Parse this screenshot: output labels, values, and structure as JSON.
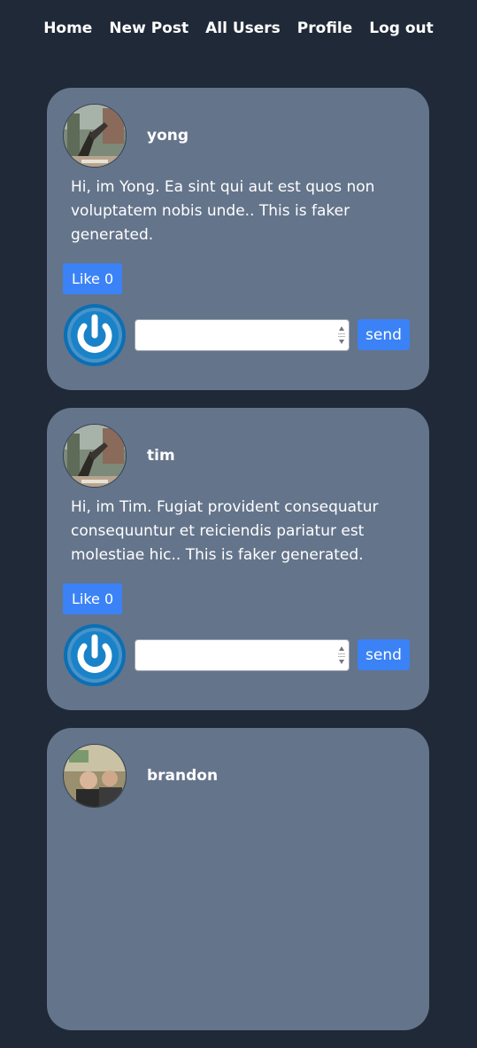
{
  "nav": {
    "items": [
      {
        "label": "Home",
        "icon": null
      },
      {
        "label": "New Post",
        "icon": null
      },
      {
        "label": "All Users",
        "icon": null
      },
      {
        "label": "Profile",
        "icon": null
      },
      {
        "label": "Log out",
        "icon": null
      }
    ]
  },
  "colors": {
    "page_bg": "#1f2937",
    "card_bg": "#64748b",
    "accent": "#3b82f6",
    "power_icon": "#0b6fb4"
  },
  "posts": [
    {
      "username": "yong",
      "avatar_icon": "user-photo-icon",
      "text": "Hi, im Yong. Ea sint qui aut est quos non voluptatem nobis unde.. This is faker generated.",
      "like_label": "Like 0",
      "comment": {
        "value": "",
        "placeholder": ""
      },
      "send_label": "send"
    },
    {
      "username": "tim",
      "avatar_icon": "user-photo-icon",
      "text": "Hi, im Tim. Fugiat provident consequatur consequuntur et reiciendis pariatur est molestiae hic.. This is faker generated.",
      "like_label": "Like 0",
      "comment": {
        "value": "",
        "placeholder": ""
      },
      "send_label": "send"
    },
    {
      "username": "brandon",
      "avatar_icon": "user-photo-icon",
      "text": "",
      "like_label": "",
      "comment": {
        "value": "",
        "placeholder": ""
      },
      "send_label": ""
    }
  ]
}
